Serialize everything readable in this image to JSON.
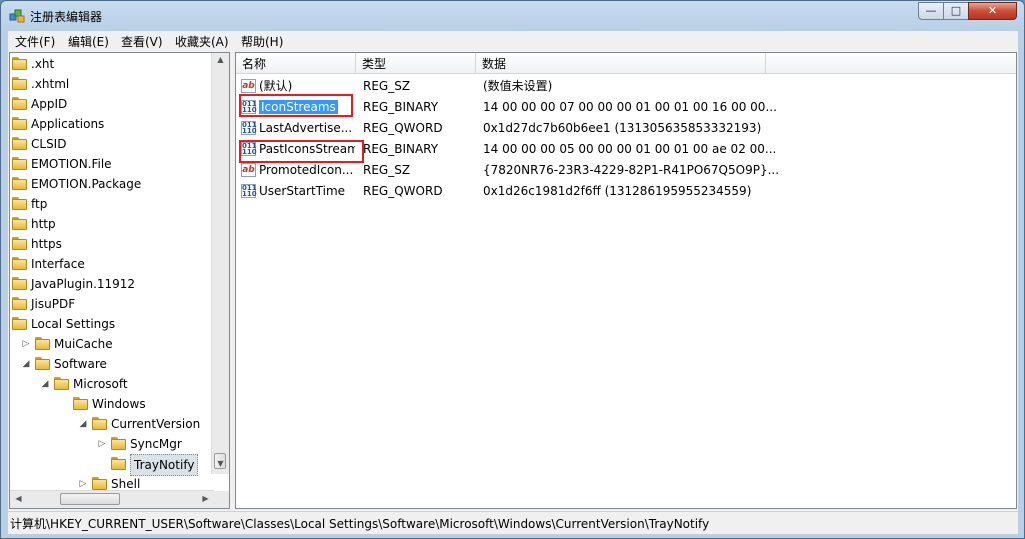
{
  "window": {
    "title": "注册表编辑器",
    "minimize": "—",
    "maximize": "□",
    "close": "✕"
  },
  "menu": [
    "文件(F)",
    "编辑(E)",
    "查看(V)",
    "收藏夹(A)",
    "帮助(H)"
  ],
  "tree": {
    "items": [
      {
        "label": ".xht",
        "expander": ""
      },
      {
        "label": ".xhtml",
        "expander": ""
      },
      {
        "label": "AppID",
        "expander": ""
      },
      {
        "label": "Applications",
        "expander": ""
      },
      {
        "label": "CLSID",
        "expander": ""
      },
      {
        "label": "EMOTION.File",
        "expander": ""
      },
      {
        "label": "EMOTION.Package",
        "expander": ""
      },
      {
        "label": "ftp",
        "expander": ""
      },
      {
        "label": "http",
        "expander": ""
      },
      {
        "label": "https",
        "expander": ""
      },
      {
        "label": "Interface",
        "expander": ""
      },
      {
        "label": "JavaPlugin.11912",
        "expander": ""
      },
      {
        "label": "JisuPDF",
        "expander": ""
      },
      {
        "label": "Local Settings",
        "expander": ""
      },
      {
        "label": "MuiCache",
        "expander": "▷"
      },
      {
        "label": "Software",
        "expander": "◢"
      },
      {
        "label": "Microsoft",
        "expander": "◢"
      },
      {
        "label": "Windows",
        "expander": ""
      },
      {
        "label": "CurrentVersion",
        "expander": "◢"
      },
      {
        "label": "SyncMgr",
        "expander": "▷"
      },
      {
        "label": "TrayNotify",
        "expander": ""
      },
      {
        "label": "Shell",
        "expander": "▷"
      }
    ],
    "selected": "TrayNotify"
  },
  "list": {
    "columns": [
      "名称",
      "类型",
      "数据"
    ],
    "rows": [
      {
        "name": "(默认)",
        "type": "REG_SZ",
        "data": "(数值未设置)",
        "icon": "string-value-icon"
      },
      {
        "name": "IconStreams",
        "type": "REG_BINARY",
        "data": "14 00 00 00 07 00 00 00 01 00 01 00 16 00 00...",
        "icon": "binary-value-icon"
      },
      {
        "name": "LastAdvertise...",
        "type": "REG_QWORD",
        "data": "0x1d27dc7b60b6ee1 (131305635853332193)",
        "icon": "binary-value-icon"
      },
      {
        "name": "PastIconsStream",
        "type": "REG_BINARY",
        "data": "14 00 00 00 05 00 00 00 01 00 01 00 ae 02 00...",
        "icon": "binary-value-icon"
      },
      {
        "name": "PromotedIcon...",
        "type": "REG_SZ",
        "data": "{7820NR76-23R3-4229-82P1-R41PO67Q5O9P}...",
        "icon": "string-value-icon"
      },
      {
        "name": "UserStartTime",
        "type": "REG_QWORD",
        "data": "0x1d26c1981d2f6ff (131286195955234559)",
        "icon": "binary-value-icon"
      }
    ],
    "selected": "IconStreams",
    "highlighted_boxes": [
      "IconStreams",
      "PastIconsStream"
    ]
  },
  "icons": {
    "string": "ab",
    "binary": "011\n110"
  },
  "statusbar": {
    "path": "计算机\\HKEY_CURRENT_USER\\Software\\Classes\\Local Settings\\Software\\Microsoft\\Windows\\CurrentVersion\\TrayNotify"
  },
  "colors": {
    "selection": "#3399ff",
    "annotation_box": "#e01e24"
  }
}
